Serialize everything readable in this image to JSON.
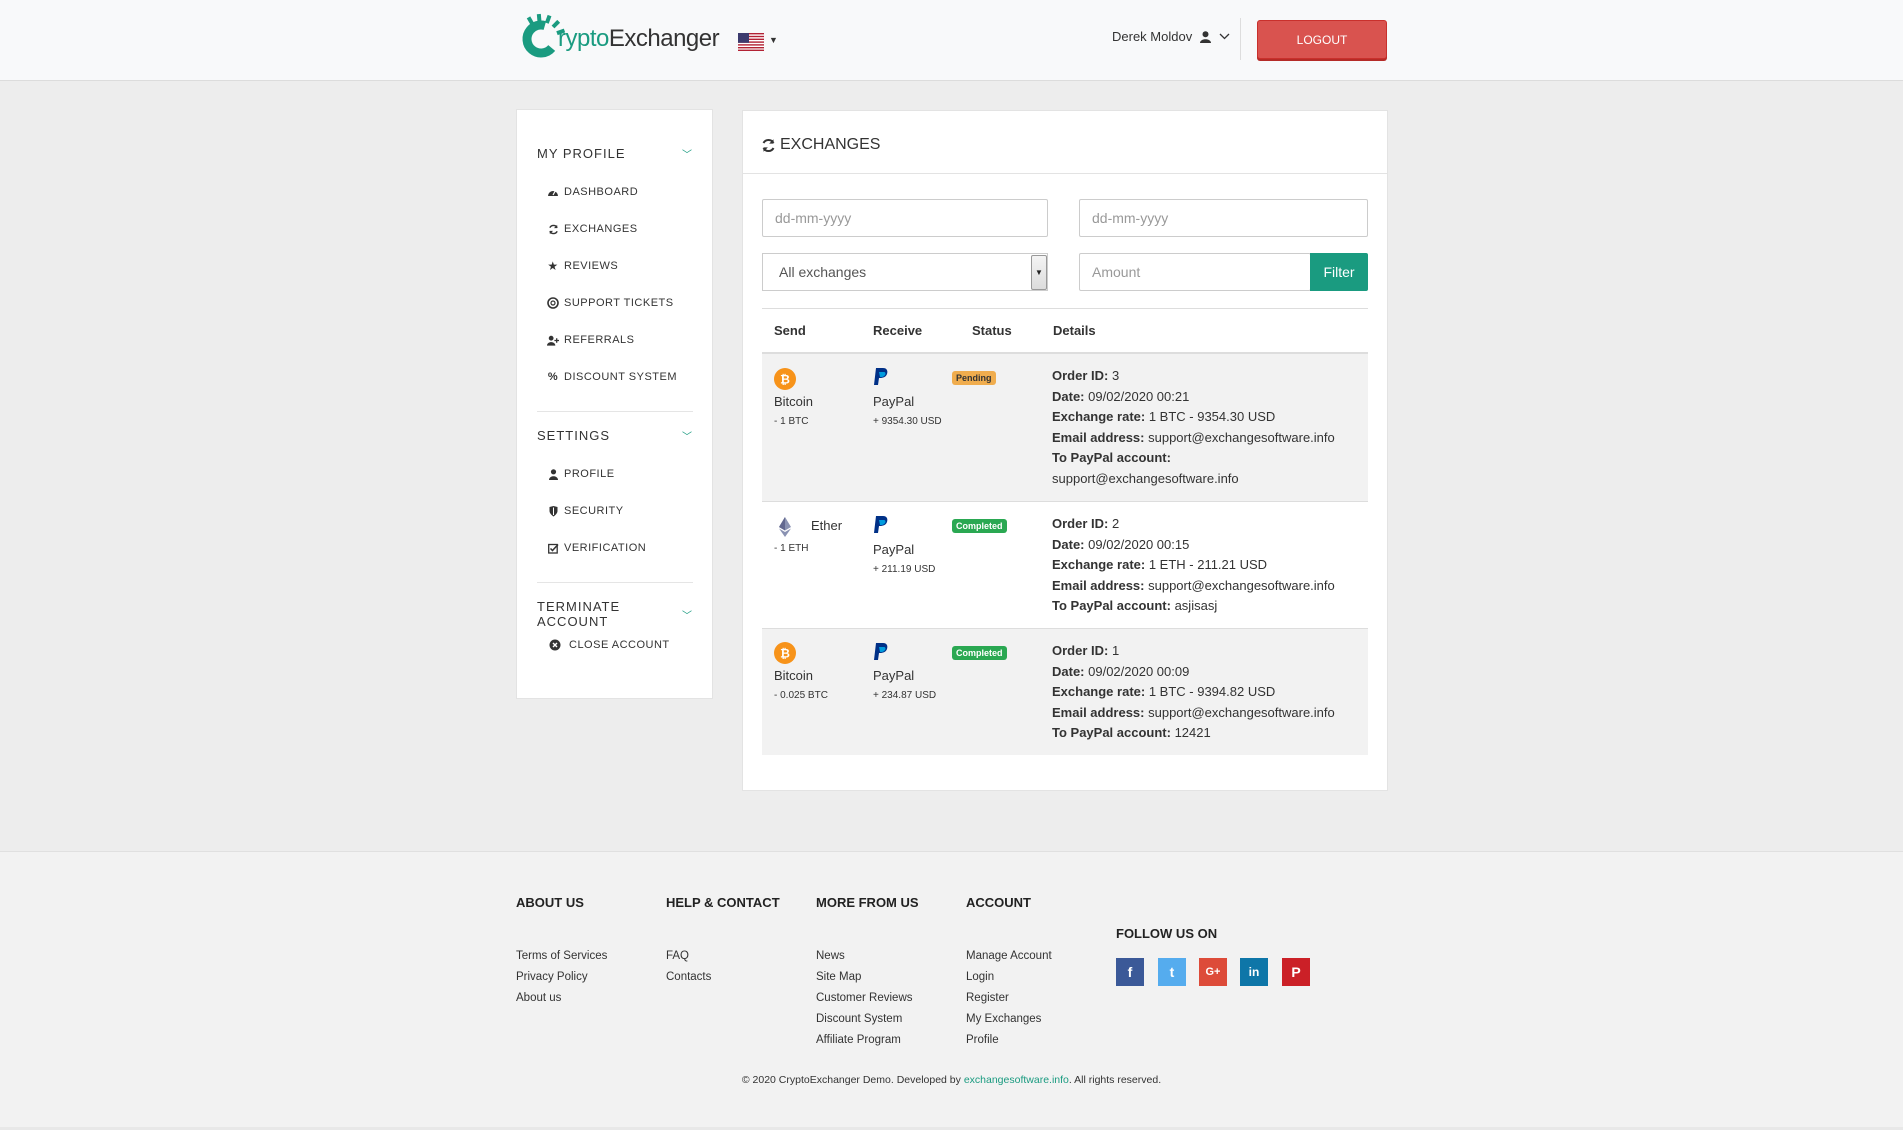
{
  "brand": {
    "logo_part1": "rypto",
    "logo_part2": "Exchanger",
    "accent": "#1a9b80"
  },
  "header": {
    "user_name": "Derek Moldov",
    "logout_label": "LOGOUT"
  },
  "sidebar": {
    "sections": [
      {
        "title": "MY PROFILE",
        "items": [
          "DASHBOARD",
          "EXCHANGES",
          "REVIEWS",
          "SUPPORT TICKETS",
          "REFERRALS",
          "DISCOUNT SYSTEM"
        ]
      },
      {
        "title": "SETTINGS",
        "items": [
          "PROFILE",
          "SECURITY",
          "VERIFICATION"
        ]
      },
      {
        "title": "TERMINATE ACCOUNT",
        "items": [
          "CLOSE ACCOUNT"
        ]
      }
    ]
  },
  "main": {
    "title": "EXCHANGES",
    "date_from_placeholder": "dd-mm-yyyy",
    "date_to_placeholder": "dd-mm-yyyy",
    "select_value": "All exchanges",
    "amount_placeholder": "Amount",
    "filter_label": "Filter",
    "columns": [
      "Send",
      "Receive",
      "Status",
      "Details"
    ],
    "rows": [
      {
        "send_name": "Bitcoin",
        "send_amount": "- 1 BTC",
        "receive_name": "PayPal",
        "receive_amount": "+ 9354.30 USD",
        "status": "Pending",
        "order_id_label": "Order ID:",
        "order_id": " 3",
        "date_label": "Date:",
        "date": " 09/02/2020 00:21",
        "rate_label": "Exchange rate:",
        "rate": " 1 BTC - 9354.30 USD",
        "email_label": "Email address:",
        "email": " support@exchangesoftware.info",
        "account_label": "To PayPal account:",
        "account": "support@exchangesoftware.info"
      },
      {
        "send_name": "Ether",
        "send_amount": "- 1 ETH",
        "receive_name": "PayPal",
        "receive_amount": "+ 211.19 USD",
        "status": "Completed",
        "order_id_label": "Order ID:",
        "order_id": " 2",
        "date_label": "Date:",
        "date": " 09/02/2020 00:15",
        "rate_label": "Exchange rate:",
        "rate": " 1 ETH - 211.21 USD",
        "email_label": "Email address:",
        "email": " support@exchangesoftware.info",
        "account_label": "To PayPal account:",
        "account": " asjisasj"
      },
      {
        "send_name": "Bitcoin",
        "send_amount": "- 0.025 BTC",
        "receive_name": "PayPal",
        "receive_amount": "+ 234.87 USD",
        "status": "Completed",
        "order_id_label": "Order ID:",
        "order_id": " 1",
        "date_label": "Date:",
        "date": " 09/02/2020 00:09",
        "rate_label": "Exchange rate:",
        "rate": " 1 BTC - 9394.82 USD",
        "email_label": "Email address:",
        "email": " support@exchangesoftware.info",
        "account_label": "To PayPal account:",
        "account": " 12421"
      }
    ]
  },
  "footer": {
    "columns": [
      {
        "title": "ABOUT US",
        "links": [
          "Terms of Services",
          "Privacy Policy",
          "About us"
        ]
      },
      {
        "title": "HELP & CONTACT",
        "links": [
          "FAQ",
          "Contacts"
        ]
      },
      {
        "title": "MORE FROM US",
        "links": [
          "News",
          "Site Map",
          "Customer Reviews",
          "Discount System",
          "Affiliate Program"
        ]
      },
      {
        "title": "ACCOUNT",
        "links": [
          "Manage Account",
          "Login",
          "Register",
          "My Exchanges",
          "Profile"
        ]
      }
    ],
    "follow_title": "FOLLOW US ON",
    "social": [
      {
        "name": "facebook",
        "glyph": "f",
        "color": "#3b5998"
      },
      {
        "name": "twitter",
        "glyph": "t",
        "color": "#55acee"
      },
      {
        "name": "google-plus",
        "glyph": "G+",
        "color": "#dd4b39"
      },
      {
        "name": "linkedin",
        "glyph": "in",
        "color": "#0e76a8"
      },
      {
        "name": "pinterest",
        "glyph": "P",
        "color": "#cb2027"
      }
    ],
    "copyright_prefix": "© 2020 CryptoExchanger Demo. Developed by ",
    "copyright_link": "exchangesoftware.info",
    "copyright_suffix": ". All rights reserved."
  }
}
